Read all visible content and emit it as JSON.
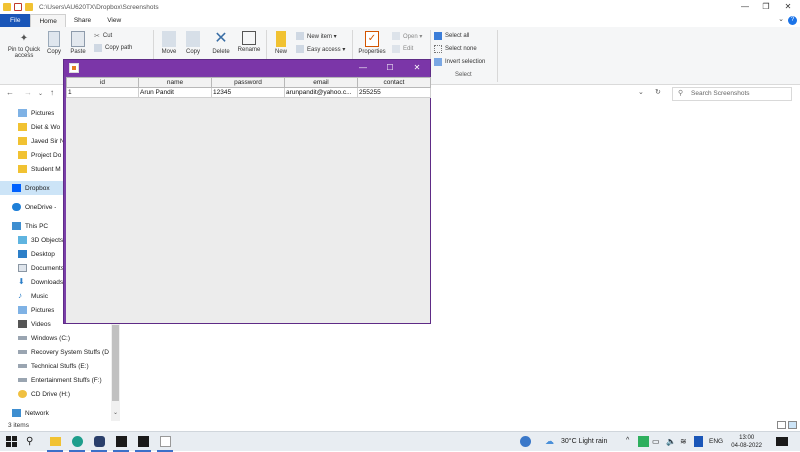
{
  "explorer": {
    "path": "C:\\Users\\AU620TX\\Dropbox\\Screenshots",
    "window_controls": {
      "minimize": "—",
      "maximize": "❐",
      "close": "✕"
    },
    "tabs": [
      "File",
      "Home",
      "Share",
      "View"
    ],
    "help": "?",
    "ribbon": {
      "pin_label": "Pin to Quick access",
      "copy": "Copy",
      "paste": "Paste",
      "cut": "Cut",
      "copy_path": "Copy path",
      "move_to": "Move",
      "copy_to": "Copy",
      "delete": "Delete",
      "rename": "Rename",
      "new": "New",
      "new_item": "New item ▾",
      "easy_access": "Easy access ▾",
      "properties": "Properties",
      "open": "Open ▾",
      "edit": "Edit",
      "select_all": "Select all",
      "select_none": "Select none",
      "invert_selection": "Invert selection",
      "select_group": "Select"
    },
    "search_placeholder": "Search Screenshots",
    "nav_items": [
      {
        "label": "Pictures",
        "icon": "pictures-icon"
      },
      {
        "label": "Diet & Wo",
        "icon": "folder-icon"
      },
      {
        "label": "Javed Sir N",
        "icon": "folder-icon"
      },
      {
        "label": "Project Do",
        "icon": "folder-icon"
      },
      {
        "label": "Student M",
        "icon": "folder-icon"
      },
      {
        "label": "Dropbox",
        "icon": "dropbox-icon"
      },
      {
        "label": "OneDrive - ",
        "icon": "onedrive-icon"
      },
      {
        "label": "This PC",
        "icon": "pc-icon"
      },
      {
        "label": "3D Objects",
        "icon": "3d-objects-icon"
      },
      {
        "label": "Desktop",
        "icon": "desktop-icon"
      },
      {
        "label": "Documents",
        "icon": "documents-icon"
      },
      {
        "label": "Downloads",
        "icon": "downloads-icon"
      },
      {
        "label": "Music",
        "icon": "music-icon"
      },
      {
        "label": "Pictures",
        "icon": "pictures-icon"
      },
      {
        "label": "Videos",
        "icon": "videos-icon"
      },
      {
        "label": "Windows (C:)",
        "icon": "drive-icon"
      },
      {
        "label": "Recovery System Stuffs (D",
        "icon": "drive-icon"
      },
      {
        "label": "Technical Stuffs (E:)",
        "icon": "drive-icon"
      },
      {
        "label": "Entertainment Stuffs (F:)",
        "icon": "drive-icon"
      },
      {
        "label": "CD Drive (H:)",
        "icon": "cd-drive-icon"
      },
      {
        "label": "Network",
        "icon": "network-icon"
      }
    ],
    "status": "3 items"
  },
  "java_window": {
    "controls": {
      "minimize": "—",
      "maximize": "☐",
      "close": "✕"
    },
    "columns": [
      "id",
      "name",
      "password",
      "email",
      "contact"
    ],
    "rows": [
      [
        "1",
        "Arun Pandit",
        "12345",
        "arunpandit@yahoo.c...",
        "255255"
      ]
    ]
  },
  "taskbar": {
    "weather": "30°C  Light rain",
    "language": "ENG",
    "time": "13:00",
    "date": "04-08-2022"
  },
  "colors": {
    "accent_file_tab": "#1a56b8",
    "java_frame": "#7b36a8",
    "selection": "#cce4f7"
  }
}
